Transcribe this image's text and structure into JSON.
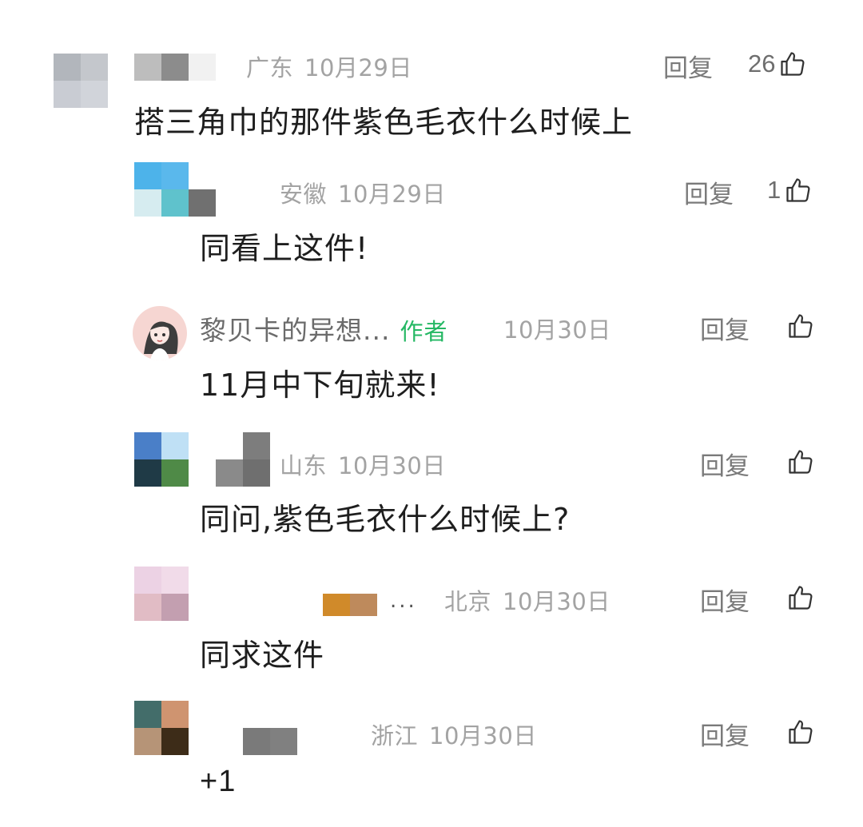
{
  "comments": [
    {
      "region": "广东",
      "date": "10月29日",
      "reply_label": "回复",
      "likes": "26",
      "text": "搭三角巾的那件紫色毛衣什么时候上",
      "avatar_colors": [
        "#b2b6bc",
        "#c4c7cc",
        "#c9ccd3",
        "#d1d4da"
      ]
    },
    {
      "region": "安徽",
      "date": "10月29日",
      "reply_label": "回复",
      "likes": "1",
      "text": "同看上这件!",
      "avatar_colors": [
        "#4db3ea",
        "#5ab8ec",
        "#d6ecf0",
        "#5fc2cc"
      ]
    },
    {
      "author_name": "黎贝卡的异想...",
      "author_tag": "作者",
      "date": "10月30日",
      "reply_label": "回复",
      "text": "11月中下旬就来!"
    },
    {
      "region": "山东",
      "date": "10月30日",
      "reply_label": "回复",
      "text": "同问,紫色毛衣什么时候上?",
      "avatar_colors": [
        "#4a7fc8",
        "#bfe0f5",
        "#1f3a46",
        "#4f8a47"
      ]
    },
    {
      "region": "北京",
      "date": "10月30日",
      "reply_label": "回复",
      "text": "同求这件",
      "name_suffix": "...",
      "avatar_colors": [
        "#ecd2e4",
        "#f1dbe9",
        "#e1bcc5",
        "#c39fb0"
      ]
    },
    {
      "region": "浙江",
      "date": "10月30日",
      "reply_label": "回复",
      "text": "+1",
      "avatar_colors": [
        "#436d6a",
        "#cf9470",
        "#b69477",
        "#3d2c18"
      ]
    }
  ],
  "icons": {
    "like": "thumbs-up-icon"
  }
}
